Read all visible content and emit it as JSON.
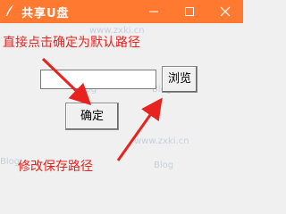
{
  "window": {
    "title": "共享U盘"
  },
  "colors": {
    "titlebar": "#ff7a30",
    "annotation": "#e8231f",
    "arrow": "#e8231f"
  },
  "icons": {
    "app": "feather-icon",
    "minimize": "minimize-icon",
    "maximize": "maximize-icon",
    "close": "close-icon"
  },
  "annotations": {
    "top": "直接点击确定为默认路径",
    "bottom": "修改保存路径"
  },
  "form": {
    "path_value": "",
    "browse_label": "浏览",
    "confirm_label": "确定"
  },
  "watermarks": [
    "www.zxki.cn",
    "Blog",
    "Blog",
    "www.zxki.cn",
    "Blog",
    "Blog"
  ]
}
